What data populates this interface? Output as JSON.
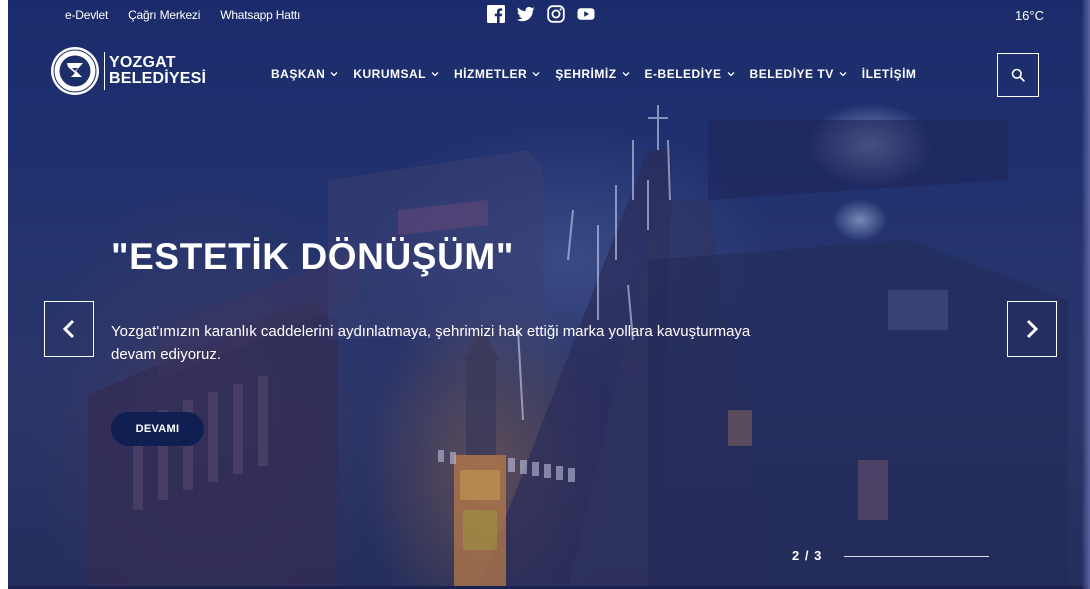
{
  "topbar": {
    "links": [
      "e-Devlet",
      "Çağrı Merkezi",
      "Whatsapp Hattı"
    ],
    "socials": [
      "facebook-icon",
      "twitter-icon",
      "instagram-icon",
      "youtube-icon"
    ],
    "temperature": "16°C"
  },
  "logo": {
    "line1": "YOZGAT",
    "line2": "BELEDİYESİ",
    "seal_year": "1874",
    "seal_ring": "YOZGAT BELEDİYESİ"
  },
  "nav": {
    "items": [
      {
        "label": "BAŞKAN",
        "dropdown": true
      },
      {
        "label": "KURUMSAL",
        "dropdown": true
      },
      {
        "label": "HİZMETLER",
        "dropdown": true
      },
      {
        "label": "ŞEHRİMİZ",
        "dropdown": true
      },
      {
        "label": "E-BELEDİYE",
        "dropdown": true
      },
      {
        "label": "BELEDİYE TV",
        "dropdown": true
      },
      {
        "label": "İLETİŞİM",
        "dropdown": false
      }
    ],
    "search_icon": "search-icon"
  },
  "hero": {
    "title": "\"ESTETİK DÖNÜŞÜM\"",
    "description": "Yozgat'ımızın karanlık caddelerini aydınlatmaya, şehrimizi hak ettiği marka yollara kavuşturmaya devam ediyoruz.",
    "button": "DEVAMI",
    "prev_icon": "chevron-left-icon",
    "next_icon": "chevron-right-icon"
  },
  "slider": {
    "counter": "2 / 3",
    "current": 2,
    "total": 3
  },
  "colors": {
    "overlay": "#1e2f6e",
    "button": "#0f1f52",
    "text": "#ffffff"
  }
}
